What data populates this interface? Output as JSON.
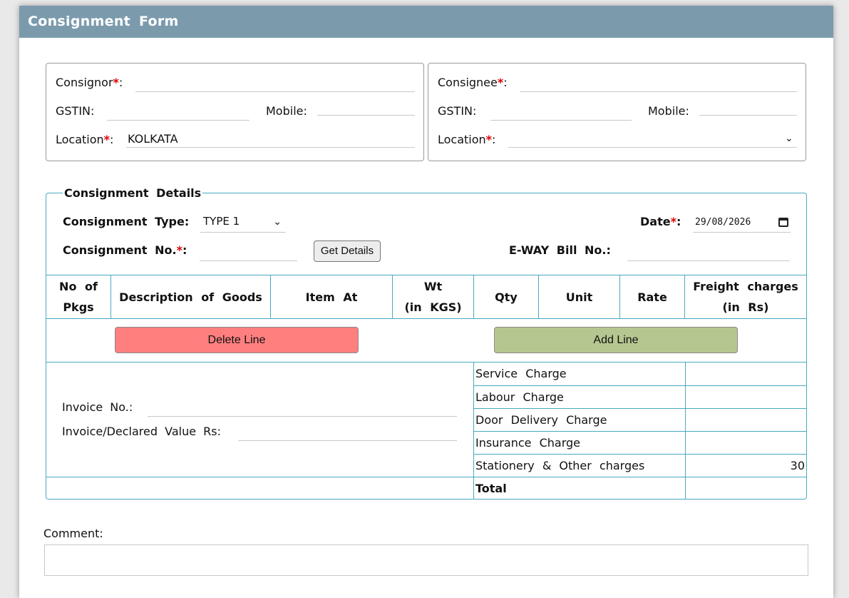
{
  "form": {
    "title": "Consignment Form"
  },
  "consignor": {
    "name_label": "Consignor",
    "gstin_label": "GSTIN:",
    "mobile_label": "Mobile:",
    "location_label": "Location",
    "location_value": "KOLKATA",
    "required_mark": "*",
    "colon": ":"
  },
  "consignee": {
    "name_label": "Consignee",
    "gstin_label": "GSTIN:",
    "mobile_label": "Mobile:",
    "location_label": "Location",
    "location_value": "",
    "required_mark": "*",
    "colon": ":"
  },
  "details": {
    "legend": "Consignment Details",
    "type_label": "Consignment Type:",
    "type_value": "TYPE 1",
    "date_label": "Date",
    "date_value": "29/08/2026",
    "number_label": "Consignment No.",
    "get_details_button": "Get Details",
    "eway_label": "E-WAY Bill No.:",
    "required_mark": "*",
    "colon": ":"
  },
  "goods_table": {
    "headers": [
      [
        "No of",
        "Pkgs"
      ],
      [
        "Description of Goods"
      ],
      [
        "Item At"
      ],
      [
        "Wt",
        "(in KGS)"
      ],
      [
        "Qty"
      ],
      [
        "Unit"
      ],
      [
        "Rate"
      ],
      [
        "Freight charges",
        "(in Rs)"
      ]
    ],
    "delete_button": "Delete Line",
    "add_button": "Add Line"
  },
  "invoice": {
    "number_label": "Invoice No.:",
    "value_label": "Invoice/Declared Value Rs:"
  },
  "charges": [
    {
      "label": "Service Charge",
      "value": ""
    },
    {
      "label": "Labour Charge",
      "value": ""
    },
    {
      "label": "Door Delivery Charge",
      "value": ""
    },
    {
      "label": "Insurance Charge",
      "value": ""
    },
    {
      "label": "Stationery & Other charges",
      "value": "30"
    },
    {
      "label": "Total",
      "value": ""
    }
  ],
  "comment": {
    "label": "Comment:",
    "value": ""
  },
  "colors": {
    "header_bg": "#7b9bad",
    "required": "#e00000",
    "delete_button": "#ff7f7f",
    "add_button": "#b5c790",
    "table_border": "#4aa8c4"
  }
}
